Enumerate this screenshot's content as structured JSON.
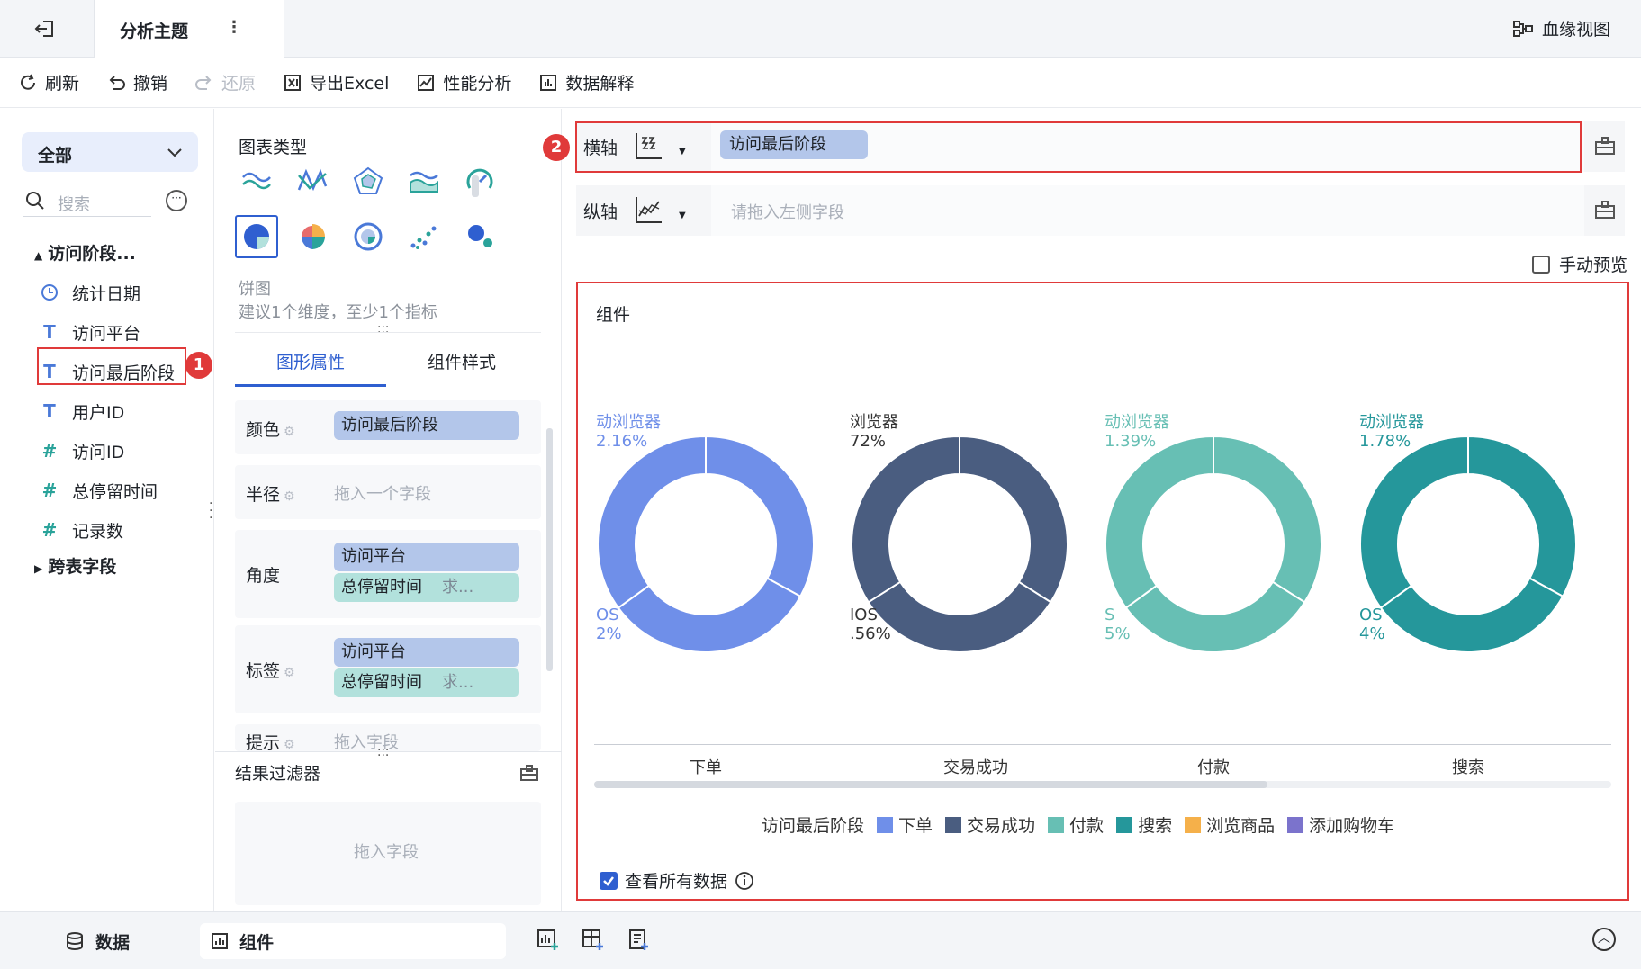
{
  "header": {
    "title": "分析主题",
    "more": "⋮",
    "lineage_label": "血缘视图"
  },
  "toolbar": {
    "refresh": "刷新",
    "undo": "撤销",
    "redo": "还原",
    "export": "导出Excel",
    "perf": "性能分析",
    "explain": "数据解释"
  },
  "fields": {
    "dataset": "全部",
    "search_placeholder": "搜索",
    "group": "访问阶段...",
    "items": [
      {
        "icon": "clock-icon",
        "label": "统计日期"
      },
      {
        "icon": "text-icon",
        "label": "访问平台"
      },
      {
        "icon": "text-icon",
        "label": "访问最后阶段"
      },
      {
        "icon": "text-icon",
        "label": "用户ID"
      },
      {
        "icon": "hash-icon",
        "label": "访问ID"
      },
      {
        "icon": "hash-icon",
        "label": "总停留时间"
      },
      {
        "icon": "hash-icon",
        "label": "记录数"
      }
    ],
    "cross_table": "跨表字段",
    "badge1": "1"
  },
  "chart_types": {
    "title": "图表类型",
    "selected_name": "饼图",
    "hint": "建议1个维度，至少1个指标"
  },
  "prop_tabs": {
    "graphic": "图形属性",
    "style": "组件样式"
  },
  "props": {
    "color_label": "颜色",
    "color_value": "访问最后阶段",
    "radius_label": "半径",
    "radius_placeholder": "拖入一个字段",
    "angle_label": "角度",
    "angle_dim": "访问平台",
    "angle_mea": "总停留时间",
    "angle_agg": "求...",
    "label_label": "标签",
    "label_dim": "访问平台",
    "label_mea": "总停留时间",
    "label_agg": "求...",
    "tip_label": "提示",
    "tip_placeholder": "拖入字段"
  },
  "filter": {
    "title": "结果过滤器",
    "placeholder": "拖入字段"
  },
  "axes": {
    "x_label": "横轴",
    "x_value": "访问最后阶段",
    "y_label": "纵轴",
    "y_placeholder": "请拖入左侧字段",
    "badge2": "2"
  },
  "manual_preview": "手动预览",
  "widget": {
    "title": "组件",
    "donut_labels": [
      {
        "a": "动浏览器",
        "b": "2.16%",
        "c": "OS",
        "d": "2%"
      },
      {
        "a": "浏览器",
        "b": "72%",
        "c": "IOS",
        "d": ".56%"
      },
      {
        "a": "动浏览器",
        "b": "1.39%",
        "c": "S",
        "d": "5%"
      },
      {
        "a": "动浏览器",
        "b": "1.78%",
        "c": "OS",
        "d": "4%"
      }
    ],
    "legend_title": "访问最后阶段",
    "view_all": "查看所有数据"
  },
  "chart_data": {
    "type": "pie",
    "categories": [
      "下单",
      "交易成功",
      "付款",
      "搜索"
    ],
    "legend": [
      {
        "name": "下单",
        "color": "#6f8fe9"
      },
      {
        "name": "交易成功",
        "color": "#4a5d80"
      },
      {
        "name": "付款",
        "color": "#67bfb4"
      },
      {
        "name": "搜索",
        "color": "#25979b"
      },
      {
        "name": "浏览商品",
        "color": "#f5b04a"
      },
      {
        "name": "添加购物车",
        "color": "#7b73cc"
      }
    ],
    "slices_fraction": [
      [
        0.33,
        0.32,
        0.35
      ],
      [
        0.34,
        0.32,
        0.34
      ],
      [
        0.34,
        0.31,
        0.35
      ],
      [
        0.33,
        0.32,
        0.35
      ]
    ]
  },
  "bottom": {
    "data_tab": "数据",
    "widget_tab": "组件"
  }
}
